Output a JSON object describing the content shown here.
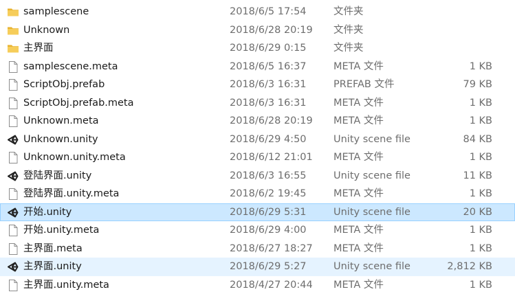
{
  "files": [
    {
      "name": "samplescene",
      "date": "2018/6/5 17:54",
      "type": "文件夹",
      "size": "",
      "icon": "folder-icon",
      "state": ""
    },
    {
      "name": "Unknown",
      "date": "2018/6/28 20:19",
      "type": "文件夹",
      "size": "",
      "icon": "folder-icon",
      "state": ""
    },
    {
      "name": "主界面",
      "date": "2018/6/29 0:15",
      "type": "文件夹",
      "size": "",
      "icon": "folder-icon",
      "state": ""
    },
    {
      "name": "samplescene.meta",
      "date": "2018/6/5 16:37",
      "type": "META 文件",
      "size": "1 KB",
      "icon": "file-icon",
      "state": ""
    },
    {
      "name": "ScriptObj.prefab",
      "date": "2018/6/3 16:31",
      "type": "PREFAB 文件",
      "size": "79 KB",
      "icon": "file-icon",
      "state": ""
    },
    {
      "name": "ScriptObj.prefab.meta",
      "date": "2018/6/3 16:31",
      "type": "META 文件",
      "size": "1 KB",
      "icon": "file-icon",
      "state": ""
    },
    {
      "name": "Unknown.meta",
      "date": "2018/6/28 20:19",
      "type": "META 文件",
      "size": "1 KB",
      "icon": "file-icon",
      "state": ""
    },
    {
      "name": "Unknown.unity",
      "date": "2018/6/29 4:50",
      "type": "Unity scene file",
      "size": "84 KB",
      "icon": "unity-icon",
      "state": ""
    },
    {
      "name": "Unknown.unity.meta",
      "date": "2018/6/12 21:01",
      "type": "META 文件",
      "size": "1 KB",
      "icon": "file-icon",
      "state": ""
    },
    {
      "name": "登陆界面.unity",
      "date": "2018/6/3 16:55",
      "type": "Unity scene file",
      "size": "11 KB",
      "icon": "unity-icon",
      "state": ""
    },
    {
      "name": "登陆界面.unity.meta",
      "date": "2018/6/2 19:45",
      "type": "META 文件",
      "size": "1 KB",
      "icon": "file-icon",
      "state": ""
    },
    {
      "name": "开始.unity",
      "date": "2018/6/29 5:31",
      "type": "Unity scene file",
      "size": "20 KB",
      "icon": "unity-icon",
      "state": "selected"
    },
    {
      "name": "开始.unity.meta",
      "date": "2018/6/29 4:00",
      "type": "META 文件",
      "size": "1 KB",
      "icon": "file-icon",
      "state": ""
    },
    {
      "name": "主界面.meta",
      "date": "2018/6/27 18:27",
      "type": "META 文件",
      "size": "1 KB",
      "icon": "file-icon",
      "state": ""
    },
    {
      "name": "主界面.unity",
      "date": "2018/6/29 5:27",
      "type": "Unity scene file",
      "size": "2,812 KB",
      "icon": "unity-icon",
      "state": "hover"
    },
    {
      "name": "主界面.unity.meta",
      "date": "2018/4/27 20:44",
      "type": "META 文件",
      "size": "1 KB",
      "icon": "file-icon",
      "state": ""
    }
  ],
  "colors": {
    "selected_bg": "#cce8ff",
    "selected_border": "#99d1ff",
    "hover_bg": "#e5f3ff",
    "folder": "#f0c04a"
  }
}
